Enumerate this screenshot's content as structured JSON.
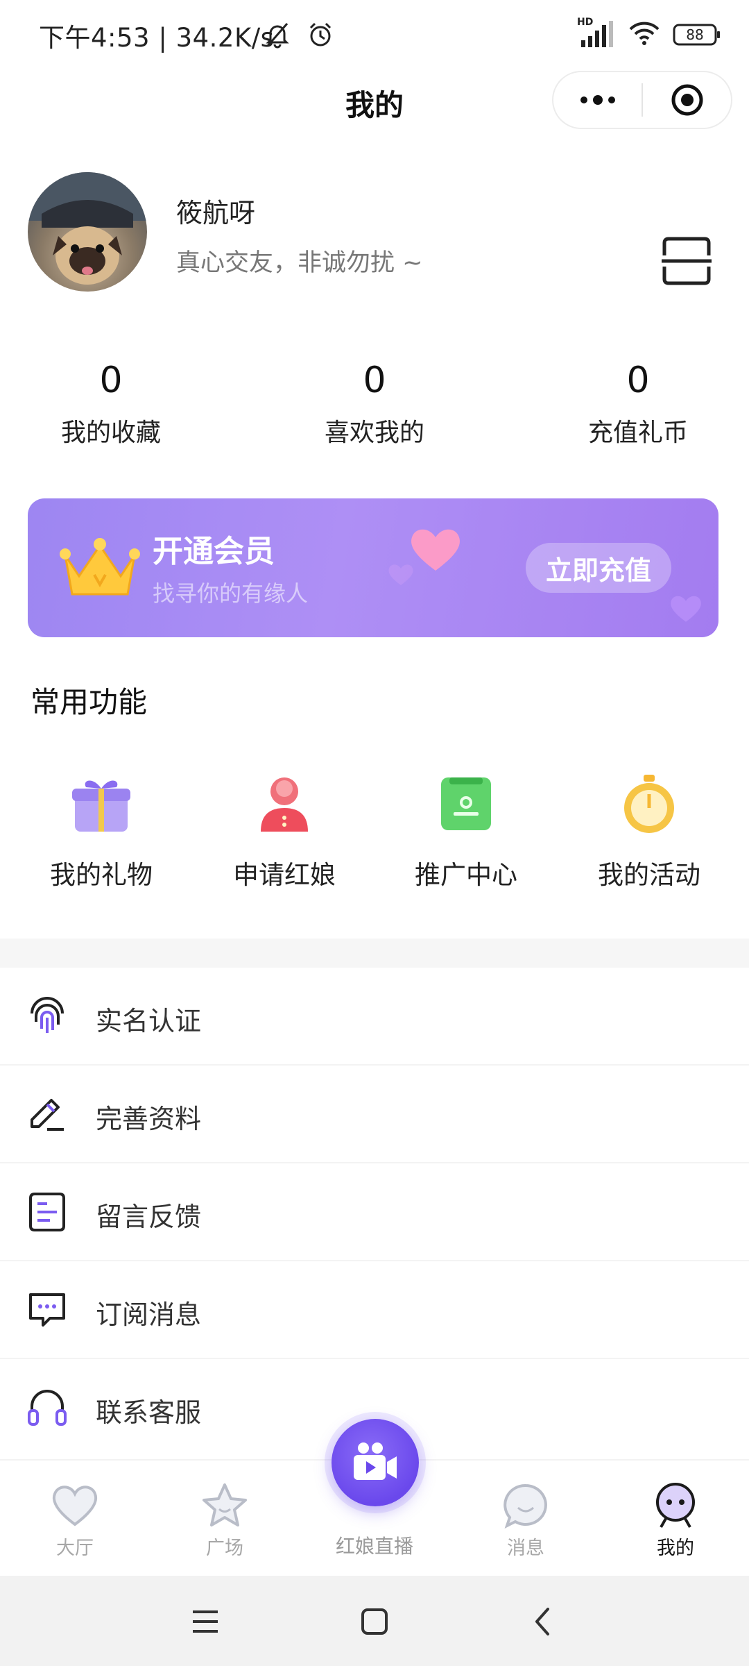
{
  "status_bar": {
    "time_speed": "下午4:53 | 34.2K/s",
    "network_label": "HD",
    "battery": "88"
  },
  "header": {
    "title": "我的"
  },
  "profile": {
    "name": "筱航呀",
    "bio": "真心交友，非诚勿扰 ~"
  },
  "stats": [
    {
      "value": "0",
      "label": "我的收藏"
    },
    {
      "value": "0",
      "label": "喜欢我的"
    },
    {
      "value": "0",
      "label": "充值礼币"
    }
  ],
  "vip_banner": {
    "title": "开通会员",
    "subtitle": "找寻你的有缘人",
    "button": "立即充值"
  },
  "common_functions": {
    "title": "常用功能",
    "items": [
      {
        "label": "我的礼物",
        "icon": "gift-icon"
      },
      {
        "label": "申请红娘",
        "icon": "matchmaker-icon"
      },
      {
        "label": "推广中心",
        "icon": "promotion-icon"
      },
      {
        "label": "我的活动",
        "icon": "activity-icon"
      }
    ]
  },
  "menu": [
    {
      "label": "实名认证",
      "icon": "fingerprint-icon"
    },
    {
      "label": "完善资料",
      "icon": "edit-icon"
    },
    {
      "label": "留言反馈",
      "icon": "feedback-icon"
    },
    {
      "label": "订阅消息",
      "icon": "message-icon"
    },
    {
      "label": "联系客服",
      "icon": "headset-icon"
    }
  ],
  "tabs": [
    {
      "label": "大厅",
      "icon": "heart-icon",
      "active": false
    },
    {
      "label": "广场",
      "icon": "star-icon",
      "active": false
    },
    {
      "label": "红娘直播",
      "icon": "video-camera-icon",
      "active": false
    },
    {
      "label": "消息",
      "icon": "chat-bubble-icon",
      "active": false
    },
    {
      "label": "我的",
      "icon": "mascot-icon",
      "active": true
    }
  ],
  "colors": {
    "accent": "#7b5cf0",
    "vip_gradient_start": "#9d86f2",
    "vip_gradient_end": "#a37cf0",
    "inactive_tab": "#a7a7a7"
  }
}
